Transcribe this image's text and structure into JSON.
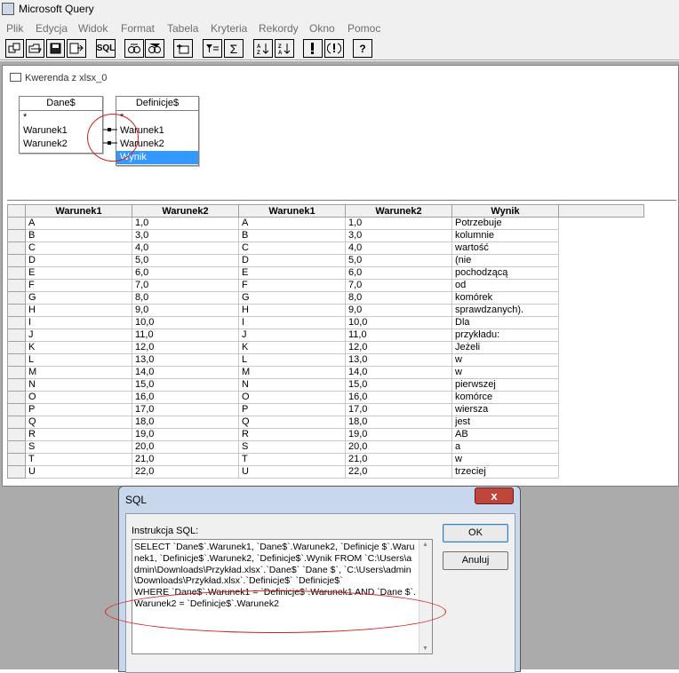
{
  "window": {
    "title": "Microsoft Query"
  },
  "menu": [
    "Plik",
    "Edycja",
    "Widok",
    "Format",
    "Tabela",
    "Kryteria",
    "Rekordy",
    "Okno",
    "Pomoc"
  ],
  "toolbar": {
    "sql_label": "SQL",
    "sigma_label": "Σ",
    "help_label": "?",
    "icons": [
      "new-query-icon",
      "open-query-icon",
      "save-icon",
      "return-data-icon",
      "sql-icon",
      "show-tables-icon",
      "show-criteria-icon",
      "add-tables-icon",
      "criteria-equals-icon",
      "totals-icon",
      "sort-ascending-icon",
      "sort-descending-icon",
      "query-now-icon",
      "auto-query-icon",
      "help-icon"
    ]
  },
  "query_window": {
    "title": "Kwerenda z xlsx_0",
    "tables": [
      {
        "name": "Dane$",
        "fields": [
          "*",
          "Warunek1",
          "Warunek2"
        ]
      },
      {
        "name": "Definicje$",
        "fields": [
          "*",
          "Warunek1",
          "Warunek2",
          "Wynik"
        ],
        "selected": "Wynik"
      }
    ],
    "grid": {
      "columns": [
        "Warunek1",
        "Warunek2",
        "Warunek1",
        "Warunek2",
        "Wynik"
      ],
      "rows": [
        [
          "A",
          "1,0",
          "A",
          "1,0",
          "Potrzebuje"
        ],
        [
          "B",
          "3,0",
          "B",
          "3,0",
          "kolumnie"
        ],
        [
          "C",
          "4,0",
          "C",
          "4,0",
          "wartość"
        ],
        [
          "D",
          "5,0",
          "D",
          "5,0",
          "(nie"
        ],
        [
          "E",
          "6,0",
          "E",
          "6,0",
          "pochodzącą"
        ],
        [
          "F",
          "7,0",
          "F",
          "7,0",
          "od"
        ],
        [
          "G",
          "8,0",
          "G",
          "8,0",
          "komórek"
        ],
        [
          "H",
          "9,0",
          "H",
          "9,0",
          "sprawdzanych)."
        ],
        [
          "I",
          "10,0",
          "I",
          "10,0",
          "Dla"
        ],
        [
          "J",
          "11,0",
          "J",
          "11,0",
          "przykładu:"
        ],
        [
          "K",
          "12,0",
          "K",
          "12,0",
          "Jeżeli"
        ],
        [
          "L",
          "13,0",
          "L",
          "13,0",
          "w"
        ],
        [
          "M",
          "14,0",
          "M",
          "14,0",
          "w"
        ],
        [
          "N",
          "15,0",
          "N",
          "15,0",
          "pierwszej"
        ],
        [
          "O",
          "16,0",
          "O",
          "16,0",
          "komórce"
        ],
        [
          "P",
          "17,0",
          "P",
          "17,0",
          "wiersza"
        ],
        [
          "Q",
          "18,0",
          "Q",
          "18,0",
          "jest"
        ],
        [
          "R",
          "19,0",
          "R",
          "19,0",
          "AB"
        ],
        [
          "S",
          "20,0",
          "S",
          "20,0",
          "a"
        ],
        [
          "T",
          "21,0",
          "T",
          "21,0",
          "w"
        ],
        [
          "U",
          "22,0",
          "U",
          "22,0",
          "trzeciej"
        ]
      ]
    }
  },
  "sql_dialog": {
    "title": "SQL",
    "close_label": "x",
    "label": "Instrukcja SQL:",
    "text": "SELECT `Dane$`.Warunek1, `Dane$`.Warunek2, `Definicje $`.Warunek1, `Definicje$`.Warunek2, `Definicje$`.Wynik FROM `C:\\Users\\admin\\Downloads\\Przykład.xlsx`.`Dane$` `Dane $`, `C:\\Users\\admin\\Downloads\\Przykład.xlsx`.`Definicje$` `Definicje$`\nWHERE `Dane$`.Warunek1 = `Definicje$`.Warunek1 AND `Dane $`.Warunek2 = `Definicje$`.Warunek2",
    "ok_label": "OK",
    "cancel_label": "Anuluj"
  },
  "colors": {
    "selection": "#3399ff",
    "annotation": "#d21e1e",
    "workspace": "#ababab",
    "dialog_frame": "#c9d7ec"
  }
}
